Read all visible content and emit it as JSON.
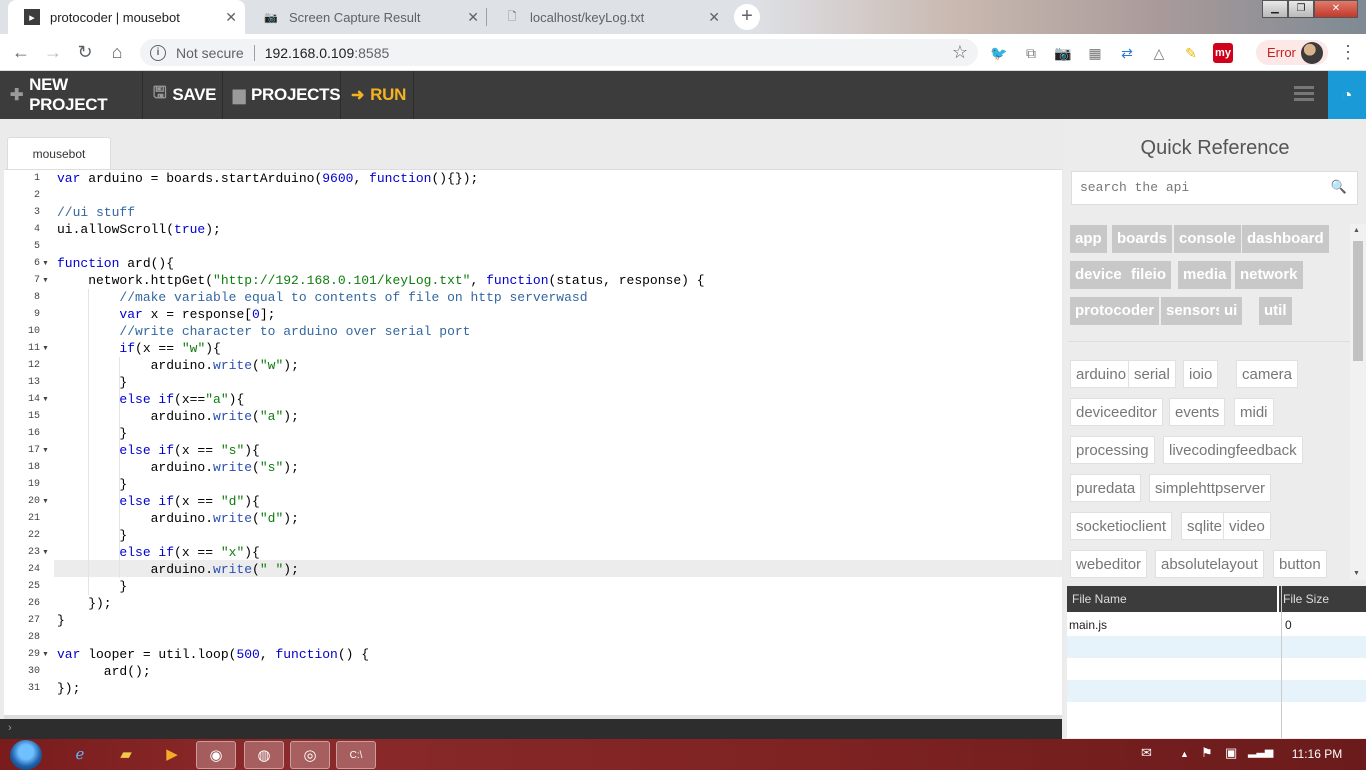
{
  "browser": {
    "tabs": [
      {
        "title": "protocoder | mousebot",
        "active": true
      },
      {
        "title": "Screen Capture Result",
        "active": false
      },
      {
        "title": "localhost/keyLog.txt",
        "active": false
      }
    ],
    "address": {
      "security_label": "Not secure",
      "host": "192.168.0.109",
      "port": ":8585"
    },
    "error_label": "Error"
  },
  "toolbar": {
    "new_project": "NEW PROJECT",
    "save": "SAVE",
    "projects": "PROJECTS",
    "run": "RUN"
  },
  "editor": {
    "file_tab": "mousebot",
    "highlighted_line": 24
  },
  "quick_reference": {
    "title": "Quick Reference",
    "search_placeholder": "search the api",
    "primary_tags": [
      "app",
      "boards",
      "console",
      "dashboard",
      "device",
      "fileio",
      "media",
      "network",
      "protocoder",
      "sensors",
      "ui",
      "util"
    ],
    "secondary_tags": [
      "arduino",
      "serial",
      "ioio",
      "camera",
      "deviceeditor",
      "events",
      "midi",
      "processing",
      "livecodingfeedback",
      "puredata",
      "simplehttpserver",
      "socketioclient",
      "sqlite",
      "video",
      "webeditor",
      "absolutelayout",
      "button"
    ]
  },
  "file_table": {
    "headers": [
      "File Name",
      "File Size"
    ],
    "rows": [
      {
        "name": "main.js",
        "size": "0"
      }
    ]
  },
  "taskbar": {
    "clock": "11:16 PM"
  },
  "colors": {
    "toolbar_bg": "#3c3c3c",
    "run_accent": "#f5b321",
    "dashboard_btn": "#1a9bd7",
    "taskbar": "#7a1c1c"
  }
}
